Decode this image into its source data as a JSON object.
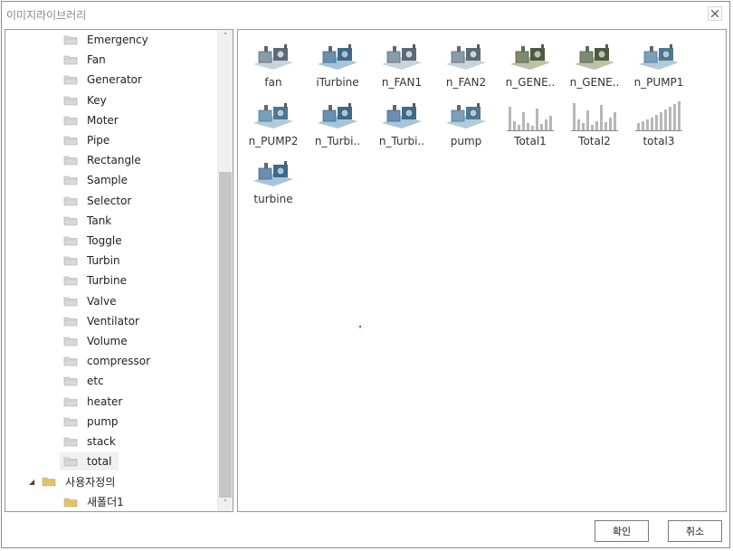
{
  "window": {
    "title": "이미지라이브러리"
  },
  "tree": {
    "items": [
      {
        "label": "Emergency"
      },
      {
        "label": "Fan"
      },
      {
        "label": "Generator"
      },
      {
        "label": "Key"
      },
      {
        "label": "Moter"
      },
      {
        "label": "Pipe"
      },
      {
        "label": "Rectangle"
      },
      {
        "label": "Sample"
      },
      {
        "label": "Selector"
      },
      {
        "label": "Tank"
      },
      {
        "label": "Toggle"
      },
      {
        "label": "Turbin"
      },
      {
        "label": "Turbine"
      },
      {
        "label": "Valve"
      },
      {
        "label": "Ventilator"
      },
      {
        "label": "Volume"
      },
      {
        "label": "compressor"
      },
      {
        "label": "etc"
      },
      {
        "label": "heater"
      },
      {
        "label": "pump"
      },
      {
        "label": "stack"
      },
      {
        "label": "total",
        "selected": true
      }
    ],
    "custom_group": {
      "label": "사용자정의",
      "expanded": true
    },
    "custom_children": [
      {
        "label": "새폴더1"
      }
    ]
  },
  "gallery": {
    "items": [
      {
        "label": "fan",
        "icon": "fan-equipment-icon"
      },
      {
        "label": "iTurbine",
        "icon": "turbine-equipment-icon"
      },
      {
        "label": "n_FAN1",
        "icon": "fan-equipment-icon"
      },
      {
        "label": "n_FAN2",
        "icon": "fan-equipment-icon"
      },
      {
        "label": "n_GENE..",
        "icon": "generator-equipment-icon"
      },
      {
        "label": "n_GENE..",
        "icon": "generator-equipment-icon"
      },
      {
        "label": "n_PUMP1",
        "icon": "pump-equipment-icon"
      },
      {
        "label": "n_PUMP2",
        "icon": "pump-equipment-icon"
      },
      {
        "label": "n_Turbi..",
        "icon": "turbine-equipment-icon"
      },
      {
        "label": "n_Turbi..",
        "icon": "turbine-equipment-icon"
      },
      {
        "label": "pump",
        "icon": "pump-equipment-icon"
      },
      {
        "label": "Total1",
        "icon": "bar-gauge-icon"
      },
      {
        "label": "Total2",
        "icon": "bar-gauge-icon"
      },
      {
        "label": "total3",
        "icon": "bar-gauge-icon"
      },
      {
        "label": "turbine",
        "icon": "turbine-equipment-icon"
      }
    ]
  },
  "buttons": {
    "ok": "확인",
    "cancel": "취소"
  },
  "colors": {
    "folder": "#e8c35a",
    "folder_gray": "#d9d9d9",
    "selected": "#f0f0f0",
    "border": "#9a9a9a"
  }
}
